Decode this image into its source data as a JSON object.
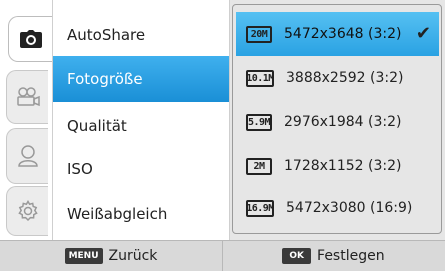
{
  "tabs": [
    {
      "icon": "camera-icon",
      "active": true
    },
    {
      "icon": "video-camera-icon",
      "active": false
    },
    {
      "icon": "person-icon",
      "active": false
    },
    {
      "icon": "gear-icon",
      "active": false
    }
  ],
  "menu": {
    "items": [
      {
        "label": "AutoShare"
      },
      {
        "label": "Fotogröße"
      },
      {
        "label": "Qualität"
      },
      {
        "label": "ISO"
      },
      {
        "label": "Weißabgleich"
      }
    ],
    "selected_index": 1
  },
  "options": {
    "items": [
      {
        "badge": "20M",
        "label": "5472x3648 (3:2)"
      },
      {
        "badge": "10.1M",
        "label": "3888x2592 (3:2)"
      },
      {
        "badge": "5.9M",
        "label": "2976x1984 (3:2)"
      },
      {
        "badge": "2M",
        "label": "1728x1152 (3:2)"
      },
      {
        "badge": "16.9M",
        "label": "5472x3080 (16:9)"
      }
    ],
    "selected_index": 0,
    "check_glyph": "✔"
  },
  "bottom": {
    "back_key": "MENU",
    "back_label": "Zurück",
    "ok_key": "OK",
    "ok_label": "Festlegen"
  },
  "colors": {
    "accent": "#1a8fd6",
    "accent_light": "#3fb0ee"
  }
}
